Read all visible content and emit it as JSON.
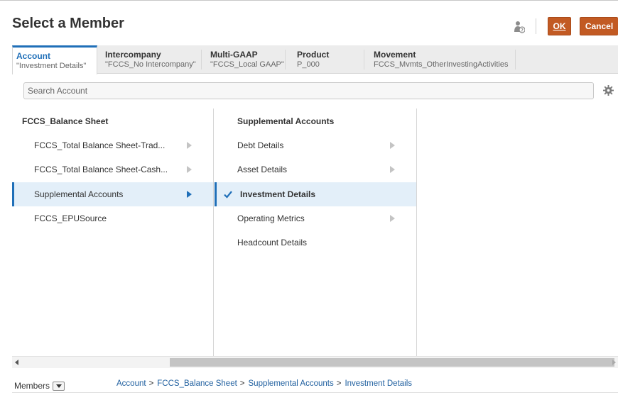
{
  "dialog": {
    "title": "Select a Member",
    "ok_label": "OK",
    "cancel_label": "Cancel"
  },
  "tabs": [
    {
      "name": "Account",
      "value": "\"Investment Details\"",
      "active": true
    },
    {
      "name": "Intercompany",
      "value": "\"FCCS_No Intercompany\""
    },
    {
      "name": "Multi-GAAP",
      "value": "\"FCCS_Local GAAP\""
    },
    {
      "name": "Product",
      "value": "P_000"
    },
    {
      "name": "Movement",
      "value": "FCCS_Mvmts_OtherInvestingActivities"
    }
  ],
  "search": {
    "placeholder": "Search Account"
  },
  "column1": {
    "header": "FCCS_Balance Sheet",
    "items": [
      {
        "label": "FCCS_Total Balance Sheet-Trad..."
      },
      {
        "label": "FCCS_Total Balance Sheet-Cash..."
      },
      {
        "label": "Supplemental Accounts"
      },
      {
        "label": "FCCS_EPUSource"
      }
    ]
  },
  "column2": {
    "header": "Supplemental Accounts",
    "items": [
      {
        "label": "Debt Details"
      },
      {
        "label": "Asset Details"
      },
      {
        "label": "Investment Details"
      },
      {
        "label": "Operating Metrics"
      },
      {
        "label": "Headcount Details"
      }
    ]
  },
  "footer": {
    "members_label": "Members",
    "breadcrumb": [
      "Account",
      "FCCS_Balance Sheet",
      "Supplemental Accounts",
      "Investment Details"
    ],
    "breadcrumb_sep": ">"
  },
  "colors": {
    "accent": "#1f6fb8",
    "button": "#c25a23",
    "selected_row": "#e3eff9"
  },
  "icons": {
    "help": "person-help-icon",
    "settings": "gear-icon",
    "selected": "check-icon",
    "expand": "chevron-right-icon"
  }
}
